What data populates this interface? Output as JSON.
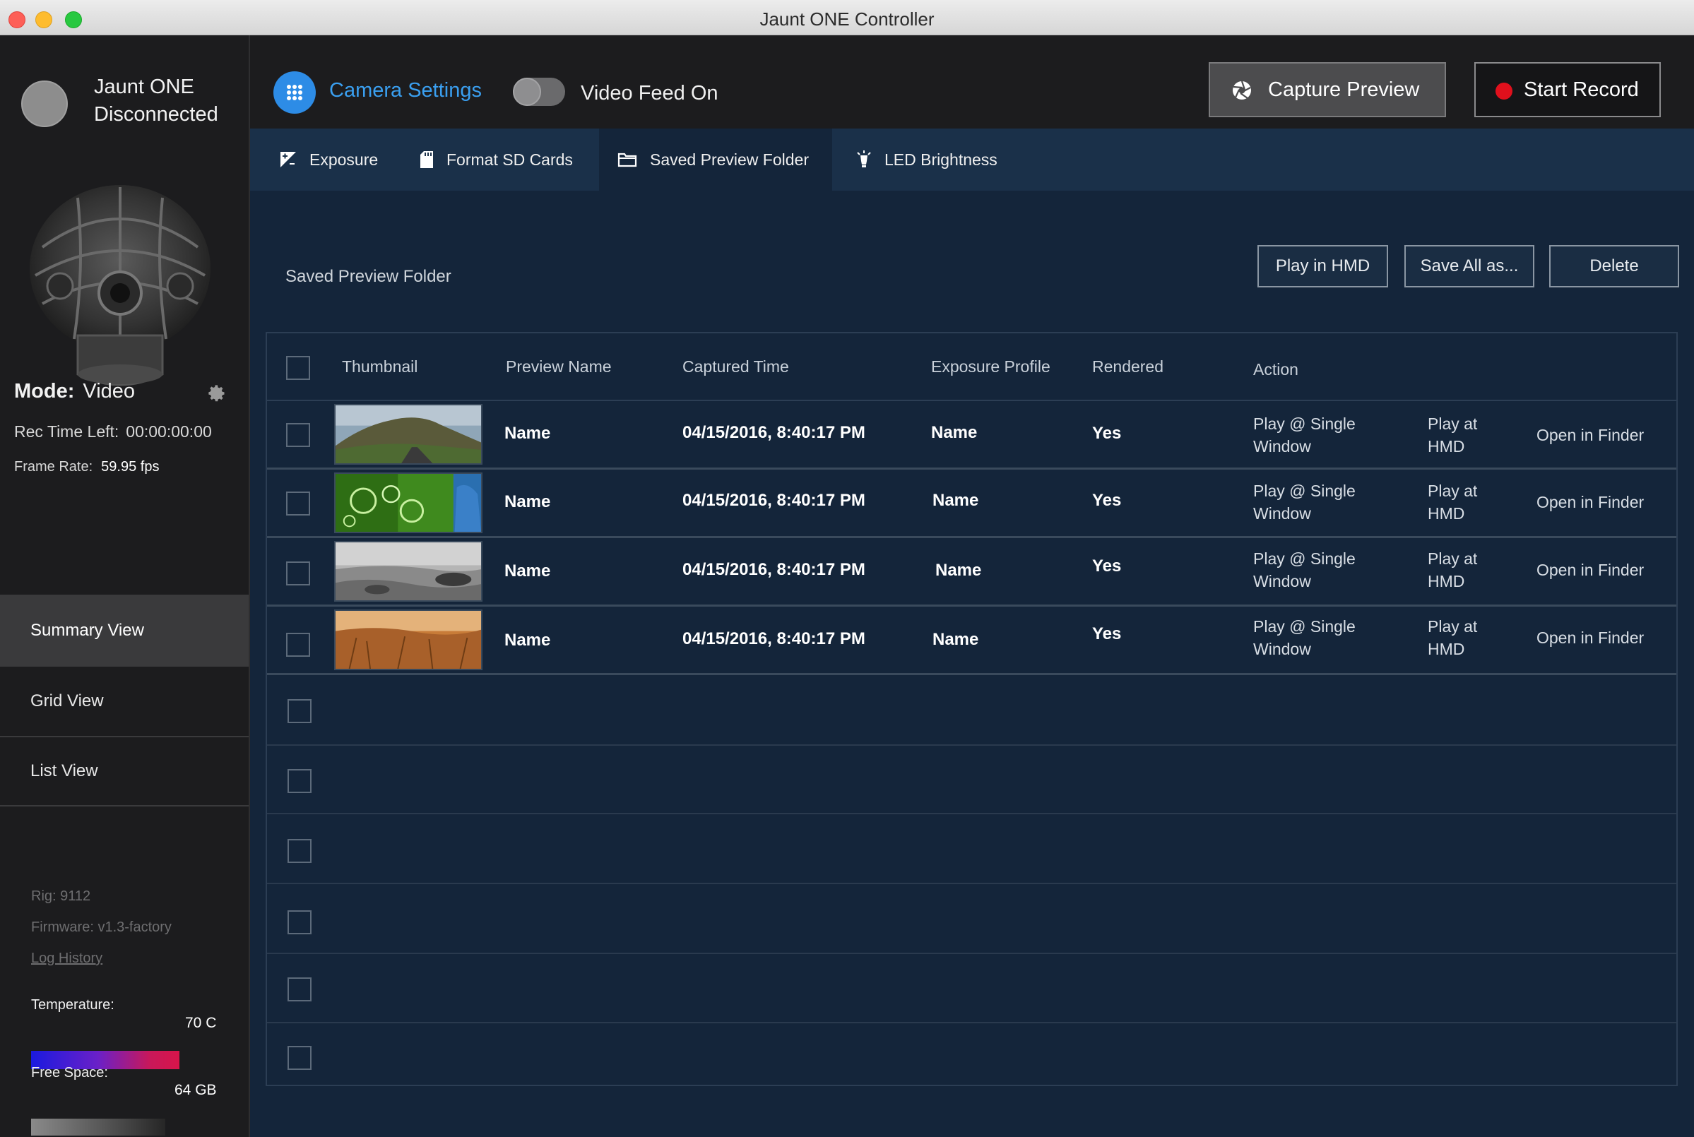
{
  "window": {
    "title": "Jaunt ONE Controller"
  },
  "device": {
    "name_line1": "Jaunt ONE",
    "name_line2": "Disconnected"
  },
  "mode": {
    "label": "Mode:",
    "value": "Video"
  },
  "rec_time": {
    "label": "Rec Time Left:",
    "value": "00:00:00:00"
  },
  "frame_rate": {
    "label": "Frame Rate:",
    "value": "59.95 fps"
  },
  "nav": [
    {
      "label": "Summary View"
    },
    {
      "label": "Grid View"
    },
    {
      "label": "List View"
    }
  ],
  "meta": {
    "rig": "Rig: 9112",
    "firmware": "Firmware:  v1.3-factory",
    "log": "Log History"
  },
  "temperature": {
    "label": "Temperature:",
    "value": "70 C"
  },
  "free_space": {
    "label": "Free Space:",
    "value": "64 GB"
  },
  "topbar": {
    "camera_settings": "Camera Settings",
    "video_feed": "Video Feed On",
    "capture_preview": "Capture Preview",
    "start_record": "Start Record"
  },
  "tabs": [
    {
      "label": "Exposure"
    },
    {
      "label": "Format SD Cards"
    },
    {
      "label": "Saved Preview Folder"
    },
    {
      "label": "LED Brightness"
    }
  ],
  "folder": {
    "title": "Saved Preview Folder",
    "play_hmd": "Play in HMD",
    "save_all": "Save All as...",
    "delete": "Delete"
  },
  "table": {
    "headers": [
      "Thumbnail",
      "Preview Name",
      "Captured Time",
      "Exposure Profile",
      "Rendered",
      "Action"
    ],
    "rows": [
      {
        "name": "Name",
        "time": "04/15/2016, 8:40:17 PM",
        "profile": "Name",
        "rendered": "Yes",
        "a1_l1": "Play @ Single",
        "a1_l2": "Window",
        "a2_l1": "Play at",
        "a2_l2": "HMD",
        "a3": "Open in Finder"
      },
      {
        "name": "Name",
        "time": "04/15/2016, 8:40:17 PM",
        "profile": "Name",
        "rendered": "Yes",
        "a1_l1": "Play @ Single",
        "a1_l2": "Window",
        "a2_l1": "Play at",
        "a2_l2": "HMD",
        "a3": "Open in Finder"
      },
      {
        "name": "Name",
        "time": "04/15/2016, 8:40:17 PM",
        "profile": "Name",
        "rendered": "Yes",
        "a1_l1": "Play @ Single",
        "a1_l2": "Window",
        "a2_l1": "Play at",
        "a2_l2": "HMD",
        "a3": "Open in Finder"
      },
      {
        "name": "Name",
        "time": "04/15/2016, 8:40:17 PM",
        "profile": "Name",
        "rendered": "Yes",
        "a1_l1": "Play @ Single",
        "a1_l2": "Window",
        "a2_l1": "Play at",
        "a2_l2": "HMD",
        "a3": "Open in Finder"
      }
    ]
  },
  "colors": {
    "accent": "#2d8ce6",
    "record": "#e0101c",
    "sidebar": "#1c1c1e",
    "content": "#14253a",
    "tabbar": "#1a3049"
  }
}
